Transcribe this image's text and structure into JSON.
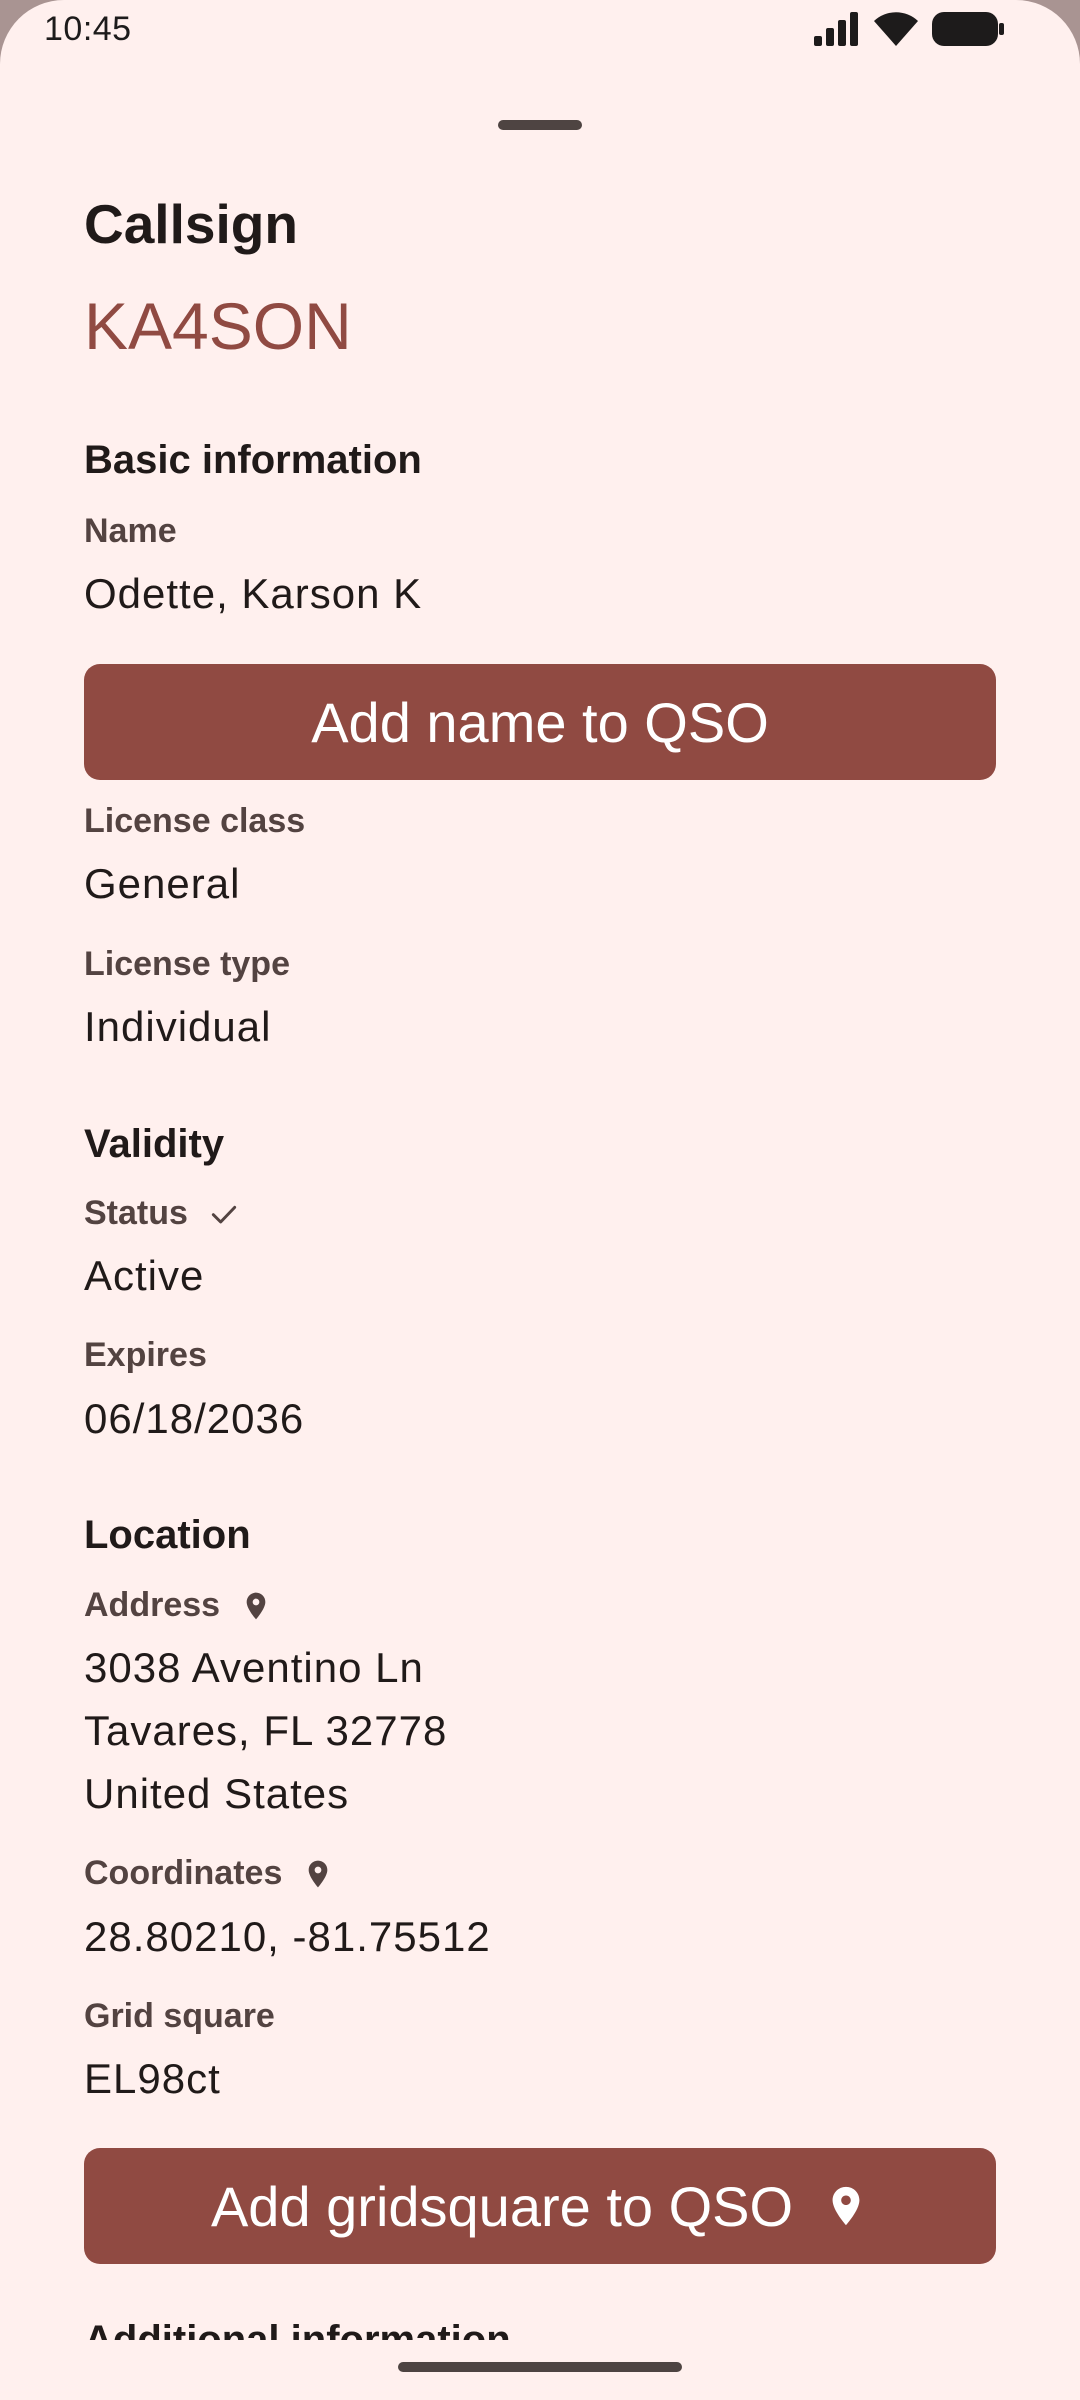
{
  "status_bar": {
    "time": "10:45",
    "icons": [
      "signal-icon",
      "wifi-icon",
      "battery-icon"
    ]
  },
  "colors": {
    "accent": "#904a42",
    "background": "#fff0ee",
    "text": "#201a19",
    "label": "#534341"
  },
  "header": {
    "title": "Callsign",
    "callsign": "KA4SON"
  },
  "basic_info": {
    "heading": "Basic information",
    "name_label": "Name",
    "name_value": "Odette, Karson K",
    "add_name_button": "Add name to QSO",
    "license_class_label": "License class",
    "license_class_value": "General",
    "license_type_label": "License type",
    "license_type_value": "Individual"
  },
  "validity": {
    "heading": "Validity",
    "status_label": "Status",
    "status_value": "Active",
    "expires_label": "Expires",
    "expires_value": "06/18/2036"
  },
  "location": {
    "heading": "Location",
    "address_label": "Address",
    "address_line1": "3038 Aventino Ln",
    "address_line2": "Tavares, FL 32778",
    "address_line3": "United States",
    "coordinates_label": "Coordinates",
    "coordinates_value": "28.80210, -81.75512",
    "grid_square_label": "Grid square",
    "grid_square_value": "EL98ct",
    "add_gridsquare_button": "Add gridsquare to QSO"
  },
  "additional_info": {
    "heading": "Additional information"
  }
}
